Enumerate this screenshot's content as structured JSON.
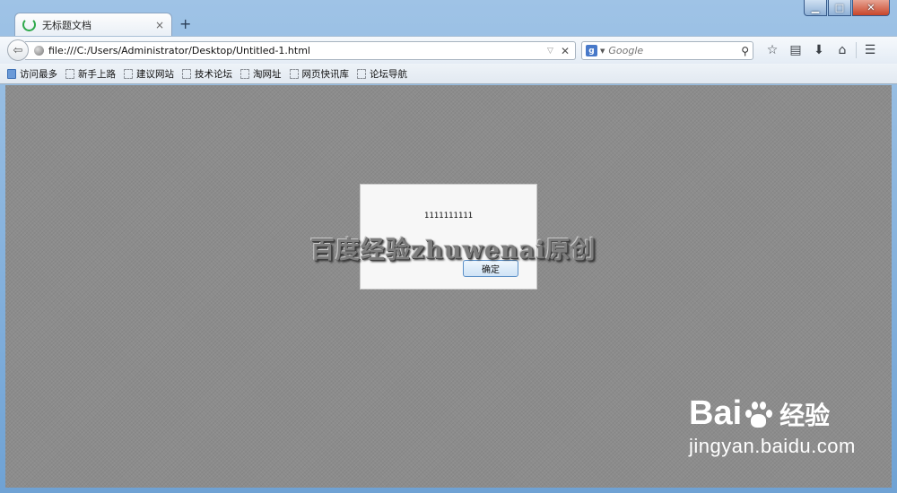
{
  "window": {
    "controls": {
      "minimize": "▁",
      "maximize": "□",
      "close": "✕"
    }
  },
  "tabs": [
    {
      "title": "无标题文档",
      "close": "×"
    }
  ],
  "new_tab": "+",
  "nav": {
    "url": "file:///C:/Users/Administrator/Desktop/Untitled-1.html",
    "search_engine": "g",
    "search_placeholder": "Google"
  },
  "bookmarks": [
    {
      "label": "访问最多"
    },
    {
      "label": "新手上路"
    },
    {
      "label": "建议网站"
    },
    {
      "label": "技术论坛"
    },
    {
      "label": "淘网址"
    },
    {
      "label": "网页快讯库"
    },
    {
      "label": "论坛导航"
    }
  ],
  "dialog": {
    "message": "1111111111",
    "ok_label": "确定"
  },
  "watermark": "百度经验zhuwenai原创",
  "baidu": {
    "word_left": "Bai",
    "word_right": "经验",
    "url": "jingyan.baidu.com"
  },
  "colors": {
    "content_bg": "#8c8c8c",
    "frame": "#6fa2d4"
  }
}
